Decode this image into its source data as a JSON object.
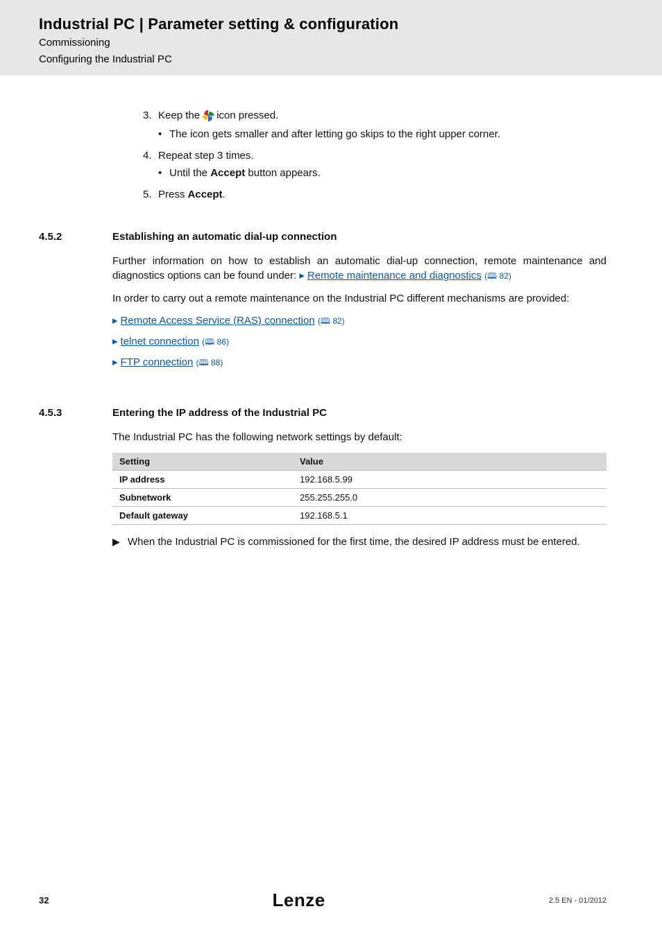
{
  "banner": {
    "title": "Industrial PC | Parameter setting & configuration",
    "sub1": "Commissioning",
    "sub2": "Configuring the Industrial PC"
  },
  "steps": {
    "s3_a": "Keep the ",
    "s3_b": " icon pressed.",
    "s3_bullet": "The icon gets smaller and after letting go skips to the right upper corner.",
    "s4": "Repeat step 3 times.",
    "s4_bullet_a": "Until the ",
    "s4_bullet_b": " button appears.",
    "accept": "Accept",
    "s5_a": "Press ",
    "s5_b": "."
  },
  "sec_dial": {
    "num": "4.5.2",
    "head": "Establishing an automatic dial-up connection",
    "p1_a": "Further information on how to establish an automatic dial-up connection, remote maintenance and diagnostics options can be found under:  ",
    "p1_link": "Remote maintenance and diagnostics",
    "p1_ref": "82",
    "p2": "In order to carry out a remote maintenance on the Industrial PC different mechanisms are provided:",
    "l1": "Remote Access Service (RAS) connection",
    "l1_ref": "82",
    "l2": "telnet connection",
    "l2_ref": "86",
    "l3": "FTP connection",
    "l3_ref": "88"
  },
  "sec_ip": {
    "num": "4.5.3",
    "head": "Entering the IP address of the Industrial PC",
    "p1": "The Industrial PC has the following network settings by default:",
    "th1": "Setting",
    "th2": "Value",
    "r1k": "IP address",
    "r1v": "192.168.5.99",
    "r2k": "Subnetwork",
    "r2v": "255.255.255.0",
    "r3k": "Default gateway",
    "r3v": "192.168.5.1",
    "note": "When the Industrial PC is commissioned for the first time, the desired IP address must be entered."
  },
  "footer": {
    "page": "32",
    "brand": "Lenze",
    "ver": "2.5 EN - 01/2012"
  }
}
